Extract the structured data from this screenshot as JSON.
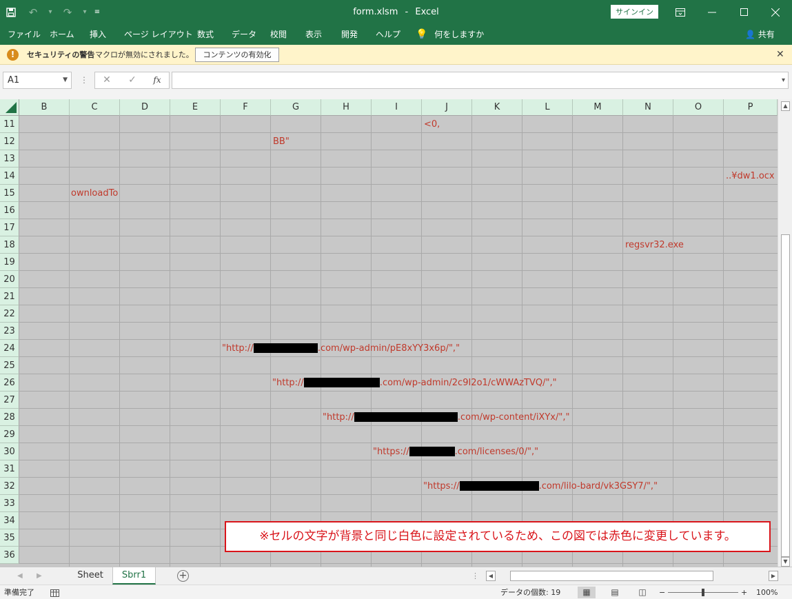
{
  "window": {
    "filename": "form.xlsm",
    "separator": "-",
    "app_name": "Excel",
    "signin_label": "サインイン"
  },
  "ribbon": {
    "tabs": [
      "ファイル",
      "ホーム",
      "挿入",
      "ページ レイアウト",
      "数式",
      "データ",
      "校閲",
      "表示",
      "開発",
      "ヘルプ"
    ],
    "tell_me": "何をしますか",
    "share": "共有"
  },
  "security_bar": {
    "title": "セキュリティの警告",
    "message": "マクロが無効にされました。",
    "enable_button": "コンテンツの有効化"
  },
  "formula_bar": {
    "name_box": "A1",
    "fx_label": "fx",
    "formula": ""
  },
  "grid": {
    "columns": [
      "B",
      "C",
      "D",
      "E",
      "F",
      "G",
      "H",
      "I",
      "J",
      "K",
      "L",
      "M",
      "N",
      "O",
      "P"
    ],
    "rows": [
      "11",
      "12",
      "13",
      "14",
      "15",
      "16",
      "17",
      "18",
      "19",
      "20",
      "21",
      "22",
      "23",
      "24",
      "25",
      "26",
      "27",
      "28",
      "29",
      "30",
      "31",
      "32",
      "33",
      "34",
      "35",
      "36"
    ],
    "cells": {
      "j11": "<0,",
      "g12": "BB\"",
      "p14": "..¥dw1.ocx",
      "c15": "ownloadTo",
      "n18": "regsvr32.exe",
      "f24_prefix": "\"http://",
      "f24_suffix": ".com/wp-admin/pE8xYY3x6p/\",\"",
      "g26_prefix": "\"http://",
      "g26_suffix": ".com/wp-admin/2c9I2o1/cWWAzTVQ/\",\"",
      "h28_prefix": "\"http://",
      "h28_suffix": ".com/wp-content/iXYx/\",\"",
      "i30_prefix": "\"https://",
      "i30_suffix": ".com/licenses/0/\",\"",
      "j32_prefix": "\"https://",
      "j32_suffix": ".com/lilo-bard/vk3GSY7/\",\""
    },
    "note": "※セルの文字が背景と同じ白色に設定されているため、この図では赤色に変更しています。"
  },
  "sheets": {
    "tabs": [
      "Sheet",
      "Sbrr1"
    ],
    "active": "Sbrr1"
  },
  "status_bar": {
    "ready": "準備完了",
    "count_label": "データの個数: 19",
    "zoom_minus": "−",
    "zoom_plus": "+",
    "zoom": "100%"
  },
  "colors": {
    "excel_green": "#217346",
    "cell_fill": "#c8c8c8",
    "revealed_text": "#c0392b",
    "note_border": "#d9141a",
    "security_bar": "#fff4ca"
  }
}
